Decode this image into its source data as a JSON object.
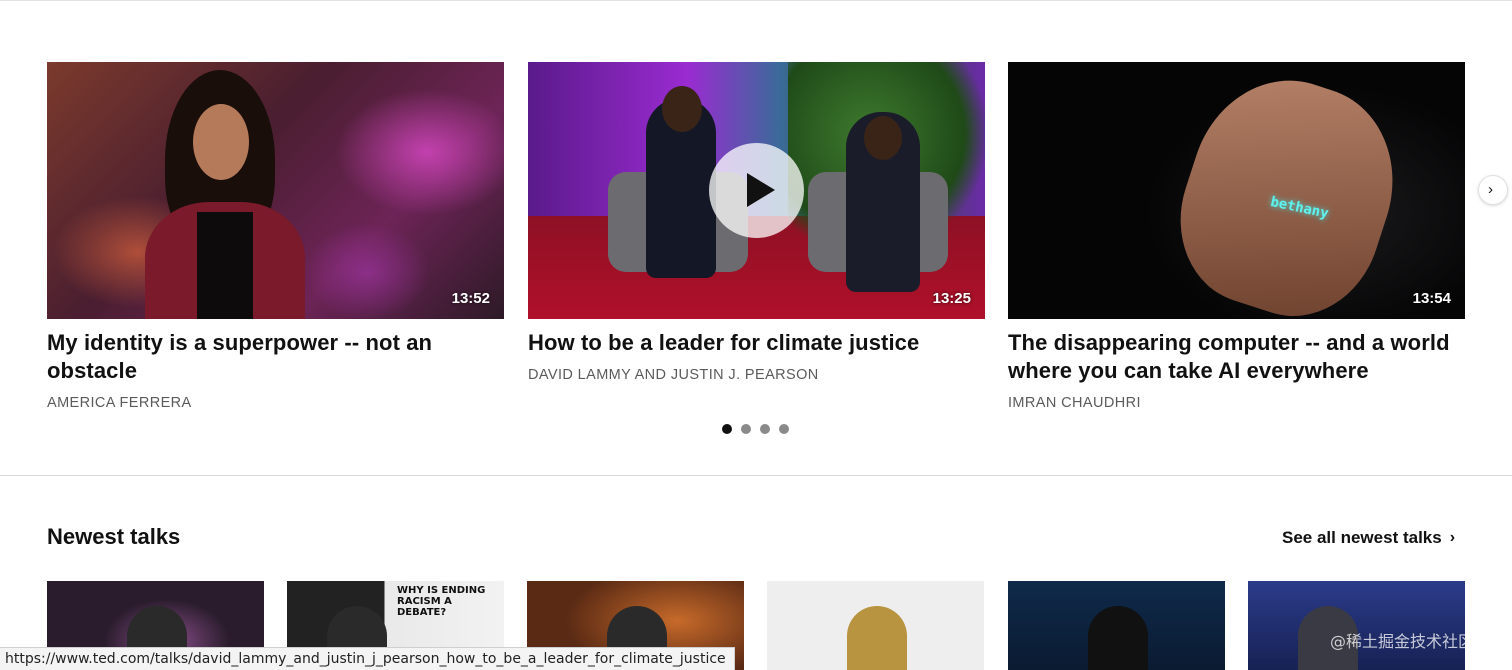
{
  "featured": {
    "cards": [
      {
        "title": "My identity is a superpower -- not an obstacle",
        "speaker": "AMERICA FERRERA",
        "duration": "13:52"
      },
      {
        "title": "How to be a leader for climate justice",
        "speaker": "DAVID LAMMY AND JUSTIN J. PEARSON",
        "duration": "13:25"
      },
      {
        "title": "The disappearing computer -- and a world where you can take AI everywhere",
        "speaker": "IMRAN CHAUDHRI",
        "duration": "13:54"
      }
    ],
    "projection_text": "bethany",
    "next_icon": "chevron-right-icon",
    "dots": 4,
    "active_dot": 1
  },
  "newest": {
    "title": "Newest talks",
    "see_all_label": "See all newest talks",
    "sign_text": "WHY IS ENDING RACISM A DEBATE?"
  },
  "status_bar": {
    "url": "https://www.ted.com/talks/david_lammy_and_justin_j_pearson_how_to_be_a_leader_for_climate_justice"
  },
  "watermark": "@稀土掘金技术社区"
}
